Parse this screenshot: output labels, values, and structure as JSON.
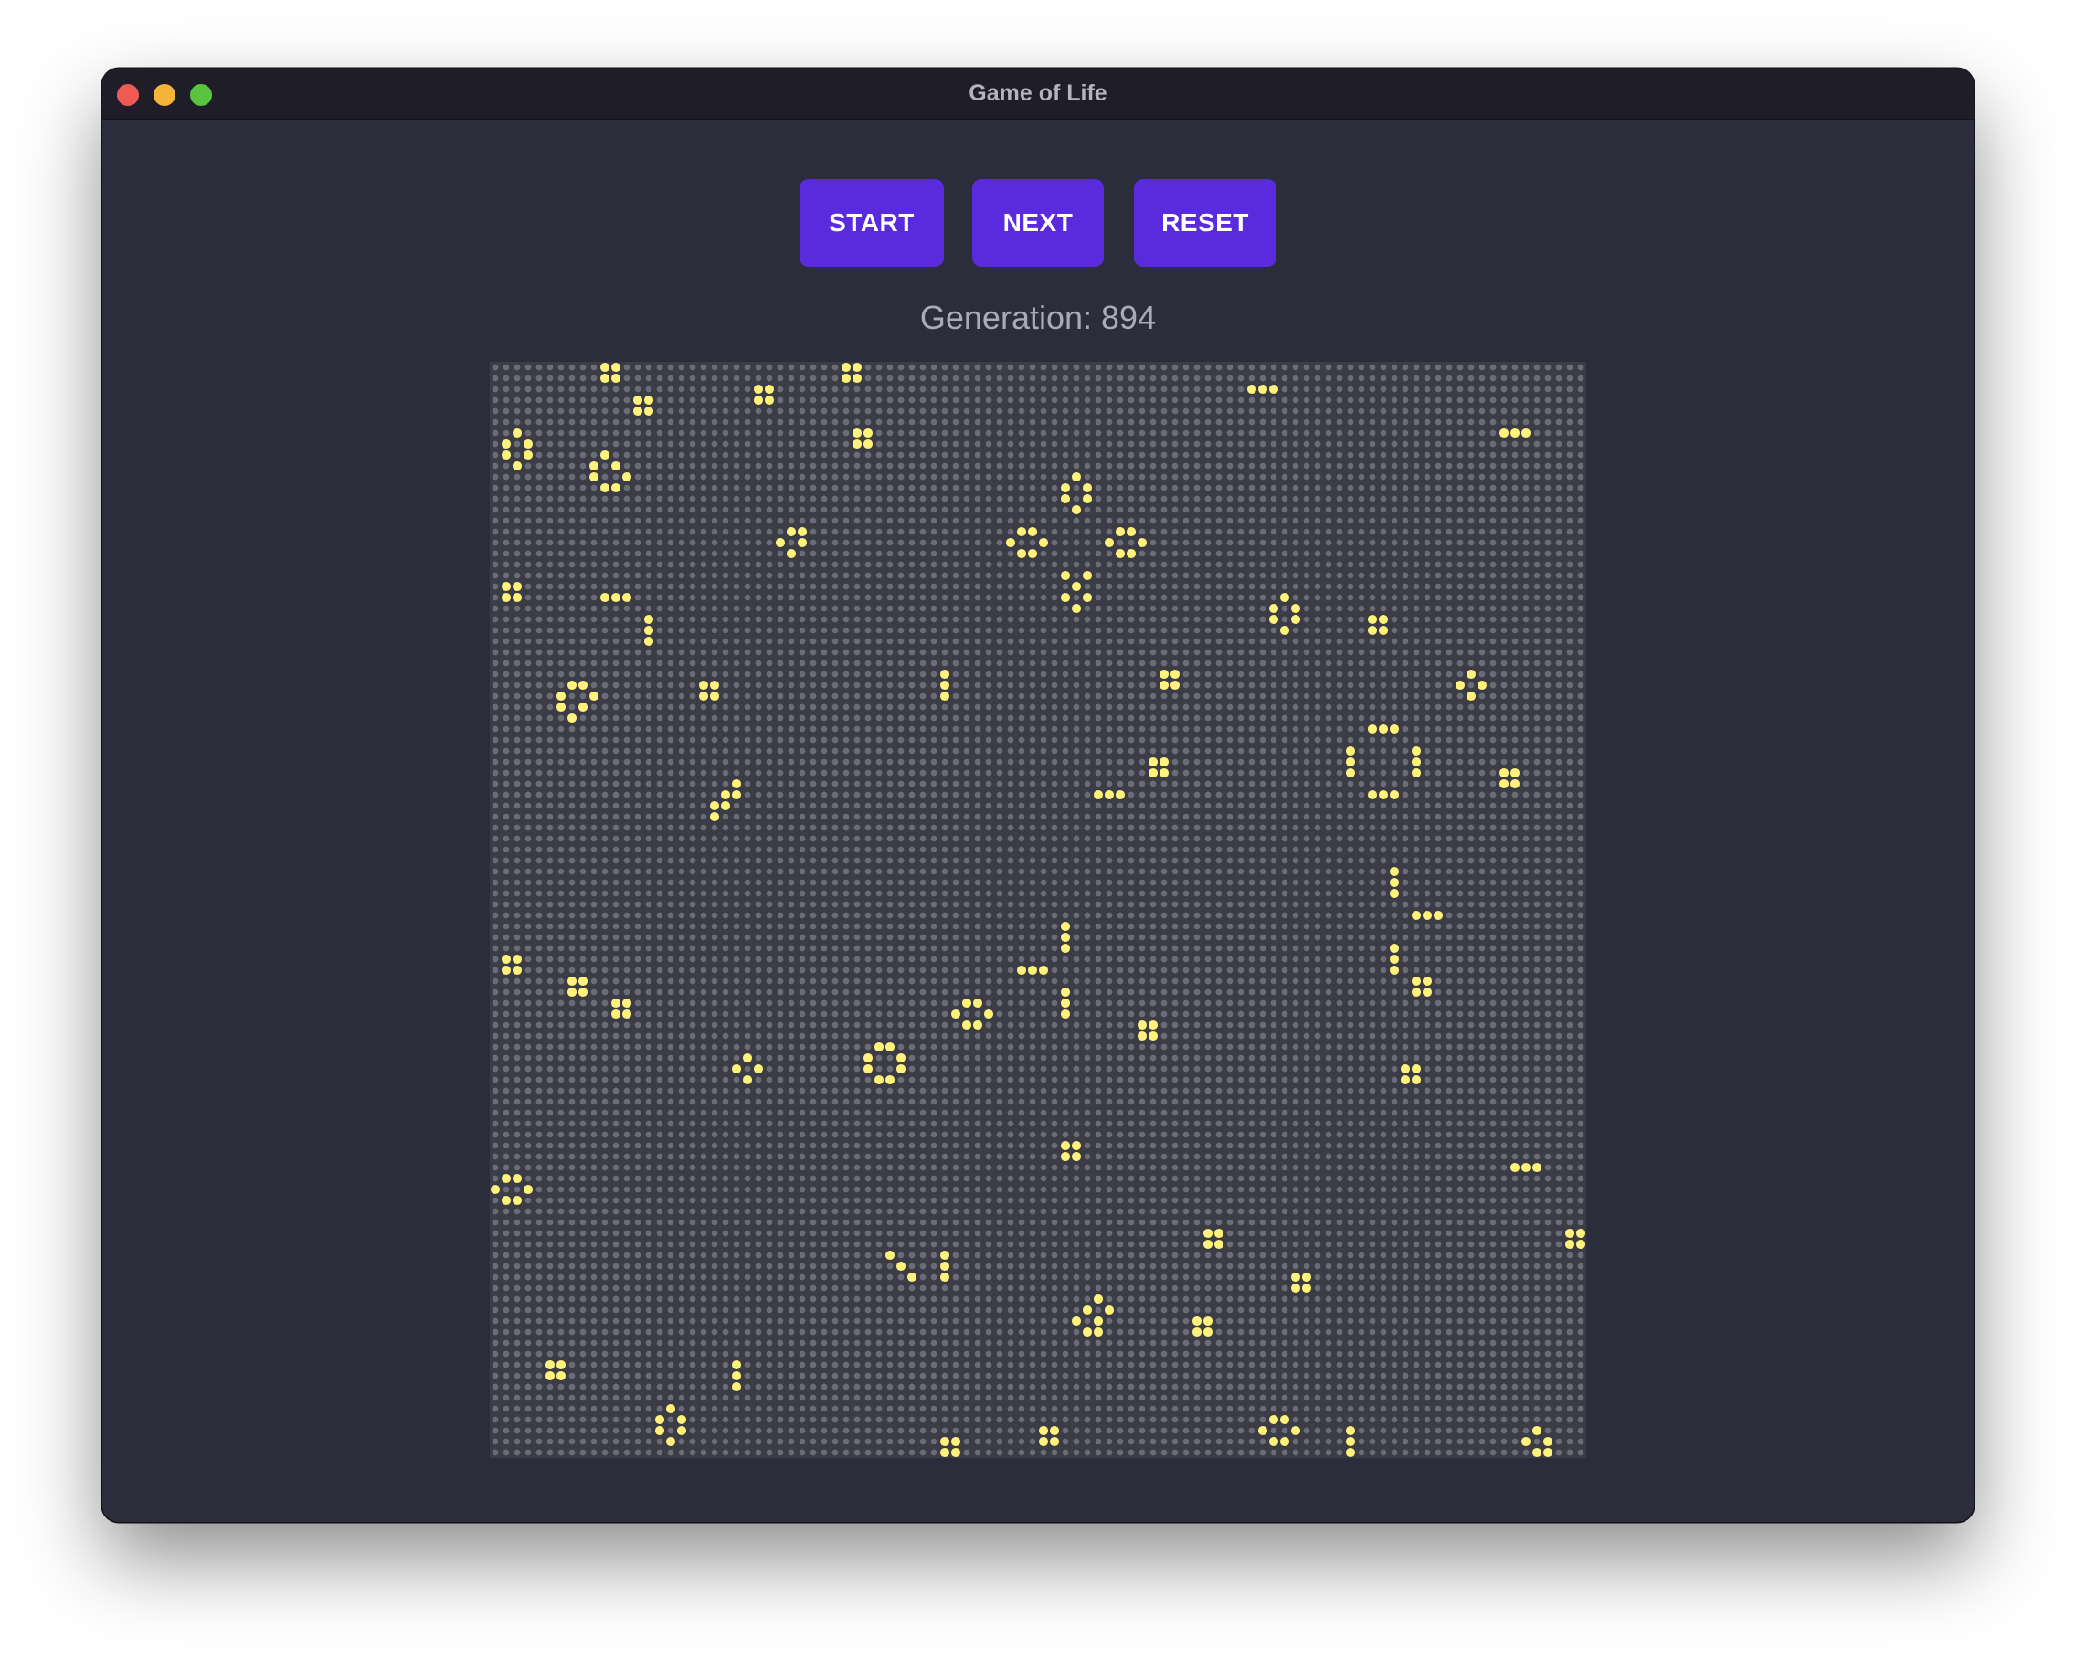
{
  "window": {
    "title": "Game of Life"
  },
  "controls": {
    "start_label": "START",
    "next_label": "NEXT",
    "reset_label": "RESET"
  },
  "status": {
    "generation_label": "Generation:",
    "generation_value": "894"
  },
  "board": {
    "rows": 100,
    "cols": 100,
    "colors": {
      "live_cell": "#fff27a",
      "dead_cell": "#6b6c77",
      "background": "#3b3c46",
      "button": "#5a2bdc",
      "window": "#2b2e3a"
    },
    "live_cells": [
      [
        0,
        10
      ],
      [
        0,
        11
      ],
      [
        1,
        10
      ],
      [
        1,
        11
      ],
      [
        0,
        32
      ],
      [
        0,
        33
      ],
      [
        1,
        32
      ],
      [
        1,
        33
      ],
      [
        2,
        24
      ],
      [
        2,
        25
      ],
      [
        3,
        24
      ],
      [
        3,
        25
      ],
      [
        3,
        13
      ],
      [
        3,
        14
      ],
      [
        4,
        13
      ],
      [
        4,
        14
      ],
      [
        2,
        69
      ],
      [
        2,
        70
      ],
      [
        2,
        71
      ],
      [
        6,
        33
      ],
      [
        6,
        34
      ],
      [
        7,
        33
      ],
      [
        7,
        34
      ],
      [
        6,
        92
      ],
      [
        6,
        93
      ],
      [
        6,
        94
      ],
      [
        6,
        2
      ],
      [
        7,
        1
      ],
      [
        7,
        3
      ],
      [
        8,
        1
      ],
      [
        8,
        3
      ],
      [
        9,
        2
      ],
      [
        8,
        10
      ],
      [
        9,
        9
      ],
      [
        9,
        11
      ],
      [
        10,
        9
      ],
      [
        10,
        12
      ],
      [
        11,
        10
      ],
      [
        11,
        11
      ],
      [
        10,
        53
      ],
      [
        11,
        52
      ],
      [
        11,
        54
      ],
      [
        12,
        52
      ],
      [
        12,
        54
      ],
      [
        13,
        53
      ],
      [
        15,
        28
      ],
      [
        15,
        27
      ],
      [
        16,
        26
      ],
      [
        16,
        28
      ],
      [
        17,
        27
      ],
      [
        15,
        48
      ],
      [
        15,
        49
      ],
      [
        16,
        47
      ],
      [
        16,
        50
      ],
      [
        17,
        48
      ],
      [
        17,
        49
      ],
      [
        15,
        57
      ],
      [
        15,
        58
      ],
      [
        16,
        56
      ],
      [
        16,
        59
      ],
      [
        17,
        57
      ],
      [
        17,
        58
      ],
      [
        20,
        53
      ],
      [
        19,
        52
      ],
      [
        19,
        54
      ],
      [
        21,
        52
      ],
      [
        21,
        54
      ],
      [
        22,
        53
      ],
      [
        20,
        1
      ],
      [
        20,
        2
      ],
      [
        21,
        1
      ],
      [
        21,
        2
      ],
      [
        21,
        10
      ],
      [
        21,
        11
      ],
      [
        21,
        12
      ],
      [
        23,
        14
      ],
      [
        24,
        14
      ],
      [
        25,
        14
      ],
      [
        21,
        72
      ],
      [
        22,
        71
      ],
      [
        22,
        73
      ],
      [
        23,
        71
      ],
      [
        23,
        73
      ],
      [
        24,
        72
      ],
      [
        23,
        80
      ],
      [
        23,
        81
      ],
      [
        24,
        80
      ],
      [
        24,
        81
      ],
      [
        28,
        41
      ],
      [
        29,
        41
      ],
      [
        30,
        41
      ],
      [
        28,
        61
      ],
      [
        28,
        62
      ],
      [
        29,
        61
      ],
      [
        29,
        62
      ],
      [
        29,
        7
      ],
      [
        29,
        8
      ],
      [
        30,
        6
      ],
      [
        30,
        9
      ],
      [
        31,
        6
      ],
      [
        31,
        8
      ],
      [
        32,
        7
      ],
      [
        29,
        19
      ],
      [
        29,
        20
      ],
      [
        30,
        19
      ],
      [
        30,
        20
      ],
      [
        28,
        89
      ],
      [
        29,
        88
      ],
      [
        29,
        90
      ],
      [
        30,
        89
      ],
      [
        33,
        80
      ],
      [
        33,
        81
      ],
      [
        33,
        82
      ],
      [
        35,
        78
      ],
      [
        36,
        78
      ],
      [
        37,
        78
      ],
      [
        35,
        84
      ],
      [
        36,
        84
      ],
      [
        37,
        84
      ],
      [
        39,
        80
      ],
      [
        39,
        81
      ],
      [
        39,
        82
      ],
      [
        36,
        60
      ],
      [
        36,
        61
      ],
      [
        37,
        60
      ],
      [
        37,
        61
      ],
      [
        37,
        92
      ],
      [
        37,
        93
      ],
      [
        38,
        92
      ],
      [
        38,
        93
      ],
      [
        38,
        22
      ],
      [
        39,
        21
      ],
      [
        39,
        22
      ],
      [
        40,
        20
      ],
      [
        40,
        21
      ],
      [
        41,
        20
      ],
      [
        39,
        55
      ],
      [
        39,
        56
      ],
      [
        39,
        57
      ],
      [
        46,
        82
      ],
      [
        47,
        82
      ],
      [
        48,
        82
      ],
      [
        50,
        84
      ],
      [
        50,
        85
      ],
      [
        50,
        86
      ],
      [
        51,
        52
      ],
      [
        52,
        52
      ],
      [
        53,
        52
      ],
      [
        53,
        82
      ],
      [
        54,
        82
      ],
      [
        55,
        82
      ],
      [
        54,
        1
      ],
      [
        54,
        2
      ],
      [
        55,
        1
      ],
      [
        55,
        2
      ],
      [
        55,
        48
      ],
      [
        55,
        49
      ],
      [
        55,
        50
      ],
      [
        56,
        7
      ],
      [
        56,
        8
      ],
      [
        57,
        7
      ],
      [
        57,
        8
      ],
      [
        56,
        84
      ],
      [
        56,
        85
      ],
      [
        57,
        84
      ],
      [
        57,
        85
      ],
      [
        57,
        52
      ],
      [
        58,
        52
      ],
      [
        59,
        52
      ],
      [
        58,
        11
      ],
      [
        58,
        12
      ],
      [
        59,
        11
      ],
      [
        59,
        12
      ],
      [
        58,
        43
      ],
      [
        58,
        44
      ],
      [
        59,
        42
      ],
      [
        59,
        45
      ],
      [
        60,
        43
      ],
      [
        60,
        44
      ],
      [
        60,
        59
      ],
      [
        60,
        60
      ],
      [
        61,
        59
      ],
      [
        61,
        60
      ],
      [
        62,
        35
      ],
      [
        62,
        36
      ],
      [
        63,
        34
      ],
      [
        63,
        37
      ],
      [
        64,
        34
      ],
      [
        64,
        37
      ],
      [
        65,
        35
      ],
      [
        65,
        36
      ],
      [
        63,
        23
      ],
      [
        64,
        22
      ],
      [
        64,
        24
      ],
      [
        65,
        23
      ],
      [
        64,
        83
      ],
      [
        64,
        84
      ],
      [
        65,
        83
      ],
      [
        65,
        84
      ],
      [
        71,
        52
      ],
      [
        71,
        53
      ],
      [
        72,
        52
      ],
      [
        72,
        53
      ],
      [
        73,
        93
      ],
      [
        73,
        94
      ],
      [
        73,
        95
      ],
      [
        74,
        1
      ],
      [
        74,
        2
      ],
      [
        75,
        0
      ],
      [
        75,
        3
      ],
      [
        76,
        1
      ],
      [
        76,
        2
      ],
      [
        79,
        65
      ],
      [
        79,
        66
      ],
      [
        80,
        65
      ],
      [
        80,
        66
      ],
      [
        79,
        98
      ],
      [
        79,
        99
      ],
      [
        80,
        98
      ],
      [
        80,
        99
      ],
      [
        81,
        36
      ],
      [
        82,
        37
      ],
      [
        81,
        41
      ],
      [
        82,
        41
      ],
      [
        83,
        38
      ],
      [
        83,
        41
      ],
      [
        83,
        73
      ],
      [
        83,
        74
      ],
      [
        84,
        73
      ],
      [
        84,
        74
      ],
      [
        85,
        55
      ],
      [
        86,
        54
      ],
      [
        86,
        56
      ],
      [
        87,
        53
      ],
      [
        87,
        55
      ],
      [
        88,
        54
      ],
      [
        88,
        55
      ],
      [
        87,
        64
      ],
      [
        87,
        65
      ],
      [
        88,
        64
      ],
      [
        88,
        65
      ],
      [
        91,
        5
      ],
      [
        91,
        6
      ],
      [
        92,
        5
      ],
      [
        92,
        6
      ],
      [
        91,
        22
      ],
      [
        92,
        22
      ],
      [
        93,
        22
      ],
      [
        95,
        16
      ],
      [
        96,
        15
      ],
      [
        96,
        17
      ],
      [
        97,
        15
      ],
      [
        97,
        17
      ],
      [
        98,
        16
      ],
      [
        96,
        71
      ],
      [
        96,
        72
      ],
      [
        97,
        70
      ],
      [
        97,
        73
      ],
      [
        98,
        71
      ],
      [
        98,
        72
      ],
      [
        97,
        78
      ],
      [
        98,
        78
      ],
      [
        99,
        78
      ],
      [
        97,
        50
      ],
      [
        97,
        51
      ],
      [
        98,
        50
      ],
      [
        98,
        51
      ],
      [
        98,
        41
      ],
      [
        98,
        42
      ],
      [
        99,
        41
      ],
      [
        99,
        42
      ],
      [
        97,
        95
      ],
      [
        98,
        94
      ],
      [
        98,
        96
      ],
      [
        99,
        95
      ],
      [
        99,
        96
      ]
    ]
  }
}
